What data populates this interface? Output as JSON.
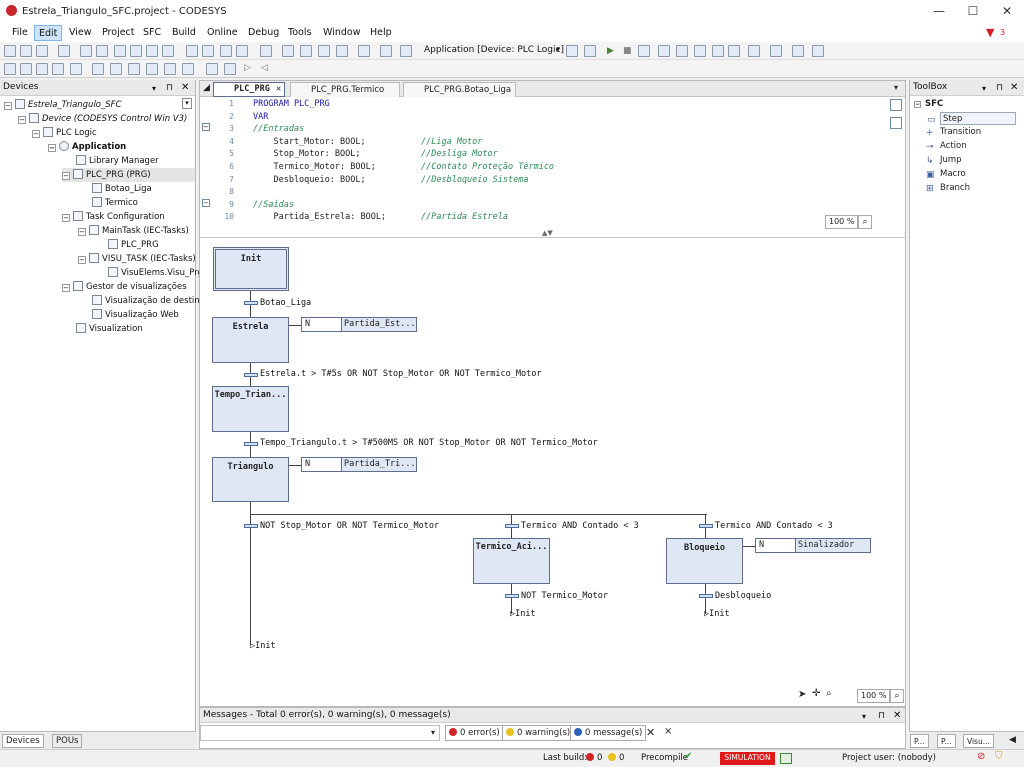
{
  "window": {
    "title": "Estrela_Triangulo_SFC.project - CODESYS",
    "min": "—",
    "max": "☐",
    "close": "✕"
  },
  "menu": [
    "File",
    "Edit",
    "View",
    "Project",
    "SFC",
    "Build",
    "Online",
    "Debug",
    "Tools",
    "Window",
    "Help"
  ],
  "notification_count": "3",
  "toolbar": {
    "application_label": "Application [Device: PLC Logic]"
  },
  "devices_panel": {
    "title": "Devices",
    "pin": "⊓",
    "close": "✕",
    "items": [
      "Estrela_Triangulo_SFC",
      "Device (CODESYS Control Win V3)",
      "PLC Logic",
      "Application",
      "Library Manager",
      "PLC_PRG (PRG)",
      "Botao_Liga",
      "Termico",
      "Task Configuration",
      "MainTask (IEC-Tasks)",
      "PLC_PRG",
      "VISU_TASK (IEC-Tasks)",
      "VisuElems.Visu_Prg",
      "Gestor de visualizações",
      "Visualização de destino",
      "Visualização Web",
      "Visualization"
    ],
    "bottom_tabs": [
      "Devices",
      "POUs"
    ]
  },
  "editor": {
    "tabs": [
      "PLC_PRG",
      "PLC_PRG.Termico",
      "PLC_PRG.Botao_Liga"
    ],
    "code_lines": [
      {
        "n": "1",
        "code": "PROGRAM PLC_PRG",
        "comment": ""
      },
      {
        "n": "2",
        "code": "VAR",
        "comment": ""
      },
      {
        "n": "3",
        "code": "//Entradas",
        "comment": ""
      },
      {
        "n": "4",
        "code": "    Start_Motor: BOOL;",
        "comment": "//Liga Motor"
      },
      {
        "n": "5",
        "code": "    Stop_Motor: BOOL;",
        "comment": "//Desliga Motor"
      },
      {
        "n": "6",
        "code": "    Termico_Motor: BOOL;",
        "comment": "//Contato Proteção Térmico"
      },
      {
        "n": "7",
        "code": "    Desbloqueio: BOOL;",
        "comment": "//Desbloqueio Sistema"
      },
      {
        "n": "8",
        "code": "",
        "comment": ""
      },
      {
        "n": "9",
        "code": "//Saídas",
        "comment": ""
      },
      {
        "n": "10",
        "code": "    Partida_Estrela: BOOL;",
        "comment": "//Partida Estrela"
      }
    ],
    "zoom_top": "100 %",
    "zoom_bottom": "100 %"
  },
  "sfc": {
    "steps": [
      "Init",
      "Estrela",
      "Tempo_Trian...",
      "Triangulo",
      "Termico_Aci...",
      "Bloqueio"
    ],
    "transitions": [
      "Botao_Liga",
      "Estrela.t > T#5s OR NOT Stop_Motor OR NOT Termico_Motor",
      "Tempo_Triangulo.t > T#500MS OR NOT Stop_Motor OR NOT Termico_Motor",
      "NOT Stop_Motor OR NOT Termico_Motor",
      "Termico AND Contado < 3",
      "Termico AND Contado < 3",
      "NOT Termico_Motor",
      "Desbloqueio"
    ],
    "actions": [
      {
        "qualifier": "N",
        "name": "Partida_Est..."
      },
      {
        "qualifier": "N",
        "name": "Partida_Tri..."
      },
      {
        "qualifier": "N",
        "name": "Sinalizador"
      }
    ],
    "jumps": [
      "Init",
      "Init",
      "Init"
    ]
  },
  "messages": {
    "title": "Messages - Total 0 error(s), 0 warning(s), 0 message(s)",
    "errors": "0 error(s)",
    "warnings": "0 warning(s)",
    "infos": "0 message(s)"
  },
  "toolbox": {
    "title": "ToolBox",
    "section": "SFC",
    "items": [
      "Step",
      "Transition",
      "Action",
      "Jump",
      "Macro",
      "Branch"
    ],
    "bottom_tabs": [
      "P...",
      "P...",
      "Visu..."
    ]
  },
  "status": {
    "last_build": "Last build:",
    "errors": "0",
    "warnings": "0",
    "precompile": "Precompile",
    "simulation": "SIMULATION",
    "project_user": "Project user: (nobody)"
  },
  "colors": {
    "accent_red": "#e0191b",
    "step_fill": "#dfe6f4",
    "keyword": "#1a1aa6",
    "comment": "#2e8a55"
  }
}
